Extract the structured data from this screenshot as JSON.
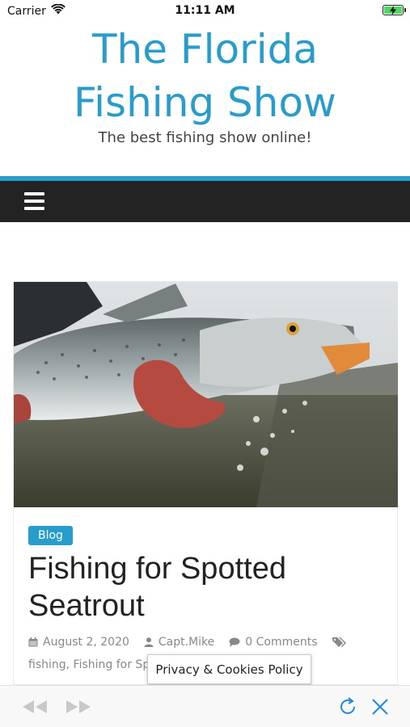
{
  "status_bar": {
    "carrier": "Carrier",
    "time": "11:11 AM"
  },
  "header": {
    "title_line1": "The Florida",
    "title_line2": "Fishing Show",
    "tagline": "The best fishing show online!"
  },
  "post": {
    "category": "Blog",
    "title_line1": "Fishing for Spotted",
    "title_line2": "Seatrout",
    "date": "August 2, 2020",
    "author": "Capt.Mike",
    "comments": "0 Comments",
    "tags": "fishing, Fishing for Spotted Seatrout, seatrout,"
  },
  "cookie_bar": {
    "label": "Privacy & Cookies Policy"
  },
  "colors": {
    "accent": "#289dcc",
    "nav": "#232323",
    "battery": "#4cd964",
    "toolbar_active": "#1e88e5",
    "toolbar_disabled": "#c7c7cc"
  },
  "icons": {
    "wifi": "wifi-icon",
    "battery": "battery-icon",
    "menu": "hamburger-menu-icon",
    "calendar": "calendar-icon",
    "author": "user-icon",
    "comments": "comment-icon",
    "tags": "tags-icon",
    "back": "rewind-icon",
    "forward": "fast-forward-icon",
    "reload": "reload-icon",
    "close": "close-icon"
  }
}
